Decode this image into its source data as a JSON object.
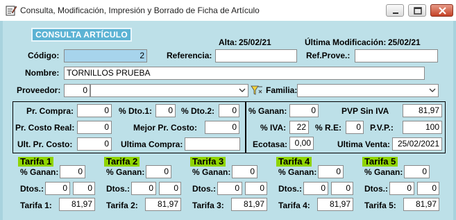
{
  "window": {
    "title": "Consulta, Modificación, Impresión y Borrado de Ficha de Artículo",
    "controls": {
      "minimize": "minimize-icon",
      "maximize": "maximize-icon",
      "close": "close-icon"
    }
  },
  "header": {
    "badge": "CONSULTA ARTÍCULO",
    "alta_label": "Alta:",
    "alta_value": "25/02/21",
    "ultima_mod_label": "Última Modificación:",
    "ultima_mod_value": "25/02/21"
  },
  "article": {
    "codigo_label": "Código:",
    "codigo_value": "2",
    "referencia_label": "Referencia:",
    "referencia_value": "",
    "refprove_label": "Ref.Prove.:",
    "refprove_value": "",
    "nombre_label": "Nombre:",
    "nombre_value": "TORNILLOS PRUEBA",
    "proveedor_label": "Proveedor:",
    "proveedor_code": "0",
    "proveedor_name": "",
    "familia_label": "Familia:",
    "familia_value": ""
  },
  "pricing": {
    "pr_compra_label": "Pr. Compra:",
    "pr_compra_value": "0",
    "dto1_label": "% Dto.1:",
    "dto1_value": "0",
    "dto2_label": "% Dto.2:",
    "dto2_value": "0",
    "pr_costo_real_label": "Pr. Costo Real:",
    "pr_costo_real_value": "0",
    "mejor_pr_costo_label": "Mejor Pr. Costo:",
    "mejor_pr_costo_value": "0",
    "ult_pr_costo_label": "Ult. Pr. Costo:",
    "ult_pr_costo_value": "0",
    "ultima_compra_label": "Ultima Compra:",
    "ultima_compra_value": "",
    "ganan_label": "% Ganan:",
    "ganan_value": "0",
    "pvp_sin_iva_label": "PVP Sin IVA",
    "pvp_sin_iva_value": "81,97",
    "iva_label": "% IVA:",
    "iva_value": "22",
    "re_label": "% R.E:",
    "re_value": "0",
    "pvp_label": "P.V.P.:",
    "pvp_value": "100",
    "ecotasa_label": "Ecotasa:",
    "ecotasa_value": "0,00",
    "ultima_venta_label": "Ultima Venta:",
    "ultima_venta_value": "25/02/2021"
  },
  "tarifas": [
    {
      "title": "Tarifa 1",
      "ganan_label": "% Ganan:",
      "ganan": "0",
      "dtos_label": "Dtos.:",
      "dto_a": "0",
      "dto_b": "0",
      "tarifa_label": "Tarifa 1:",
      "tarifa_value": "81,97"
    },
    {
      "title": "Tarifa 2",
      "ganan_label": "% Ganan:",
      "ganan": "0",
      "dtos_label": "Dtos.:",
      "dto_a": "0",
      "dto_b": "0",
      "tarifa_label": "Tarifa 2:",
      "tarifa_value": "81,97"
    },
    {
      "title": "Tarifa 3",
      "ganan_label": "% Ganan:",
      "ganan": "0",
      "dtos_label": "Dtos.:",
      "dto_a": "0",
      "dto_b": "0",
      "tarifa_label": "Tarifa 3:",
      "tarifa_value": "81,97"
    },
    {
      "title": "Tarifa 4",
      "ganan_label": "% Ganan:",
      "ganan": "0",
      "dtos_label": "Dtos.:",
      "dto_a": "0",
      "dto_b": "0",
      "tarifa_label": "Tarifa 4:",
      "tarifa_value": "81,97"
    },
    {
      "title": "Tarifa 5",
      "ganan_label": "% Ganan:",
      "ganan": "0",
      "dtos_label": "Dtos.:",
      "dto_a": "0",
      "dto_b": "0",
      "tarifa_label": "Tarifa 5:",
      "tarifa_value": "81,97"
    }
  ],
  "icons": {
    "app": "edit-form-icon",
    "filter": "filter-icon",
    "dropdown": "chevron-down-icon"
  }
}
